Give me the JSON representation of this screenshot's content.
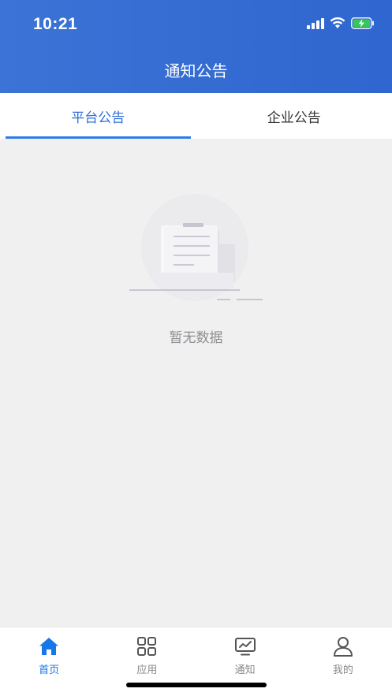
{
  "status_bar": {
    "time": "10:21",
    "icons": [
      "signal-icon",
      "wifi-icon",
      "battery-charging-icon"
    ]
  },
  "header": {
    "title": "通知公告"
  },
  "tabs": [
    {
      "label": "平台公告",
      "active": true
    },
    {
      "label": "企业公告",
      "active": false
    }
  ],
  "empty_state": {
    "text": "暂无数据",
    "illustration": "empty-document-icon"
  },
  "tabbar": {
    "items": [
      {
        "label": "首页",
        "icon": "home-icon",
        "active": true
      },
      {
        "label": "应用",
        "icon": "grid-icon",
        "active": false
      },
      {
        "label": "通知",
        "icon": "monitor-chart-icon",
        "active": false
      },
      {
        "label": "我的",
        "icon": "user-icon",
        "active": false
      }
    ]
  },
  "colors": {
    "header_bg": "#3b73d6",
    "tab_active": "#2f6fdb",
    "tabbar_active": "#1877e8",
    "background": "#f0f0f0"
  }
}
